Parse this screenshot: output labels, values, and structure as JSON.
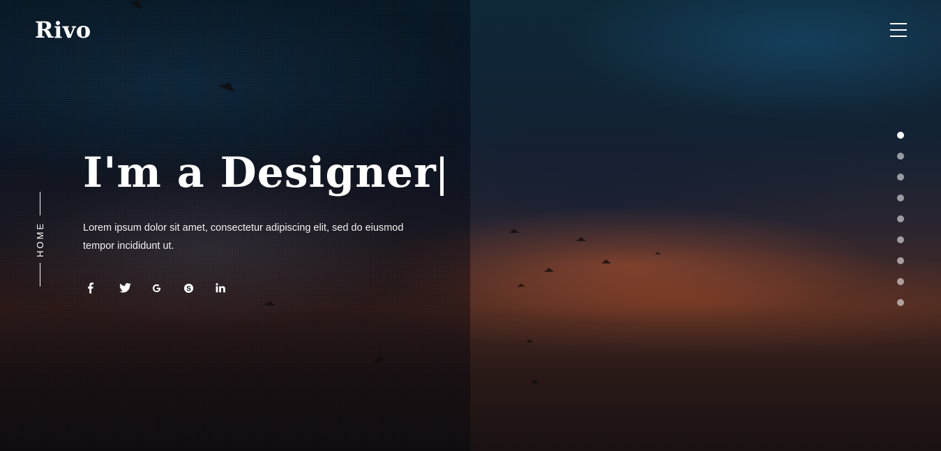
{
  "brand": {
    "name": "Rivo"
  },
  "nav": {
    "menu_icon": "hamburger-icon"
  },
  "side_label": {
    "text": "HOME"
  },
  "hero": {
    "headline": "I'm a Designer",
    "cursor": "|",
    "description": "Lorem ipsum dolor sit amet, consectetur adipiscing elit, sed do eiusmod tempor incididunt ut."
  },
  "social": [
    {
      "icon": "facebook-icon"
    },
    {
      "icon": "twitter-icon"
    },
    {
      "icon": "google-icon"
    },
    {
      "icon": "skype-icon"
    },
    {
      "icon": "linkedin-icon"
    }
  ],
  "slider_dots": {
    "count": 9,
    "active_index": 0
  },
  "colors": {
    "text": "#ffffff",
    "dot_inactive": "#a7a9ac",
    "dot_active": "#ffffff"
  }
}
